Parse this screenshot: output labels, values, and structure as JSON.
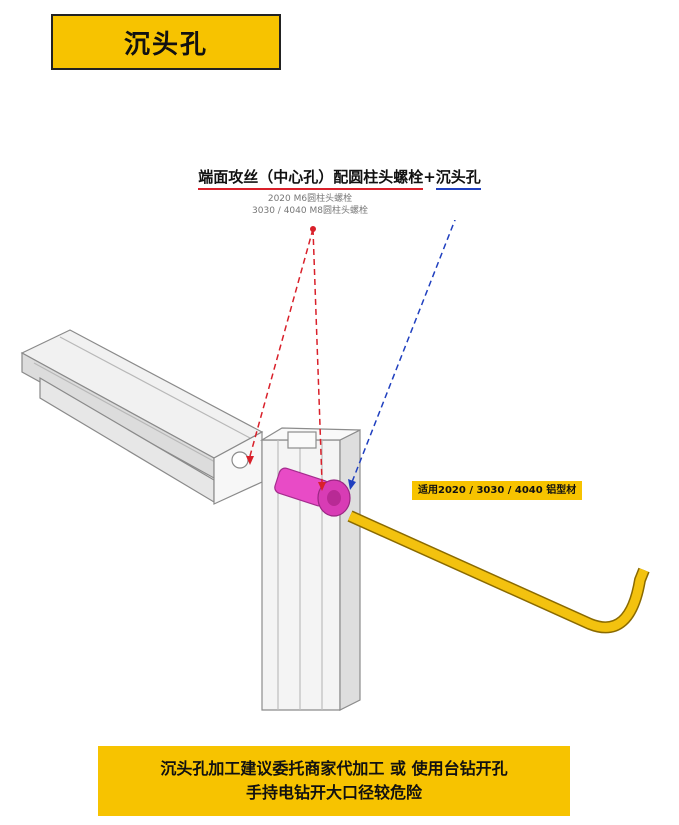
{
  "title": "沉头孔",
  "header": {
    "red_text": "端面攻丝（中心孔）配圆柱头螺栓",
    "plus": "+",
    "blue_text": "沉头孔"
  },
  "notes": {
    "line1": "2020 M6圆柱头螺栓",
    "line2": "3030 / 4040 M8圆柱头螺栓"
  },
  "tag": "适用2020 / 3030 / 4040 铝型材",
  "bottom": {
    "line1": "沉头孔加工建议委托商家代加工 或 使用台钻开孔",
    "line2": "手持电钻开大口径较危险"
  },
  "colors": {
    "accent_yellow": "#f7c300",
    "bolt_pink": "#e040c0",
    "red_line": "#d9202a",
    "blue_line": "#1f3fbf"
  },
  "icons": {
    "bolt": "socket-head-bolt-icon",
    "hex_key": "hex-key-icon"
  }
}
